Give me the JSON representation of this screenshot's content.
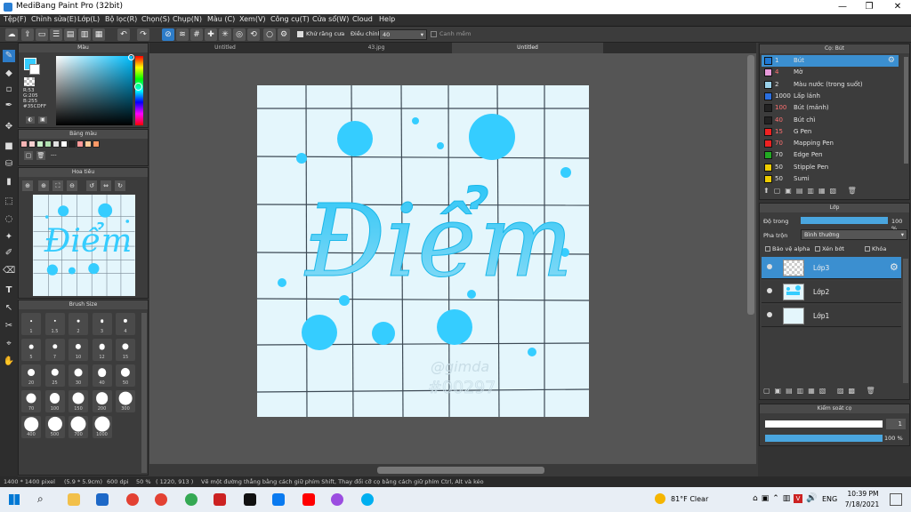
{
  "window": {
    "title": "MediBang Paint Pro (32bit)",
    "min": "—",
    "max": "❐",
    "close": "✕"
  },
  "menu": [
    "Tệp(F)",
    "Chỉnh sửa(E)",
    "Lớp(L)",
    "Bộ lọc(R)",
    "Chọn(S)",
    "Chụp(N)",
    "Màu (C)",
    "Xem(V)",
    "Công cụ(T)",
    "Cửa sổ(W)",
    "Cloud",
    "Help"
  ],
  "toolbar": {
    "antialias_label": "Khử răng cưa",
    "correction_label": "Điều chỉnh",
    "correction_value": "40",
    "smoothing_label": "Canh mềm"
  },
  "tabs": [
    "Untitled",
    "43.jpg",
    "Untitled"
  ],
  "panels": {
    "color": "Màu",
    "palette": "Bảng màu",
    "navigator": "Hoa tiêu",
    "brush_size": "Brush Size",
    "brush": "Cọ: Bút",
    "layer": "Lớp",
    "brush_control": "Kiểm soát cọ"
  },
  "color": {
    "r": "R:53",
    "g": "G:205",
    "b": "B:255",
    "hex": "#35CDFF",
    "fg": "#35cdff"
  },
  "palette": {
    "colors": [
      "#f5b5b5",
      "#f5d0d0",
      "#c8f0c8",
      "#b0e0b0",
      "#e0e0e0",
      "#ffffff",
      "#222222",
      "#ff9999",
      "#ffcc99",
      "#ff9966"
    ],
    "hint": "---"
  },
  "brushes": [
    {
      "size": "1",
      "name": "Bút",
      "color": "#1e78d4",
      "selected": true
    },
    {
      "size": "4",
      "name": "Mờ",
      "color": "#e89adb"
    },
    {
      "size": "2",
      "name": "Màu nước (trong suốt)",
      "color": "#9ad1ea"
    },
    {
      "size": "1000",
      "name": "Lấp lánh",
      "color": "#2a6fe0"
    },
    {
      "size": "100",
      "name": "Bút (mảnh)",
      "color": "#222222"
    },
    {
      "size": "40",
      "name": "Bút chì",
      "color": "#222222"
    },
    {
      "size": "15",
      "name": "G Pen",
      "color": "#ee2222"
    },
    {
      "size": "70",
      "name": "Mapping Pen",
      "color": "#ee2222"
    },
    {
      "size": "70",
      "name": "Edge Pen",
      "color": "#22aa22"
    },
    {
      "size": "50",
      "name": "Stipple Pen",
      "color": "#eecc00"
    },
    {
      "size": "50",
      "name": "Sumi",
      "color": "#eecc00"
    }
  ],
  "layer": {
    "opacity_label": "Độ trong",
    "opacity_value": "100 %",
    "blend_label": "Pha trộn",
    "blend_value": "Bình thường",
    "protect_alpha": "Bảo vệ alpha",
    "clipping": "Xén bớt",
    "lock": "Khóa",
    "layers": [
      {
        "name": "Lớp3",
        "selected": true
      },
      {
        "name": "Lớp2"
      },
      {
        "name": "Lớp1"
      }
    ]
  },
  "brush_control": {
    "size": "1",
    "opacity": "100 %"
  },
  "brush_sizes": [
    "1",
    "1.5",
    "2",
    "3",
    "4",
    "5",
    "7",
    "10",
    "12",
    "15",
    "20",
    "25",
    "30",
    "40",
    "50",
    "70",
    "100",
    "150",
    "200",
    "300",
    "400",
    "500",
    "700",
    "1000"
  ],
  "canvas": {
    "text": "Điểm",
    "watermark": "@gimda\n#00297"
  },
  "status": {
    "size": "1400 * 1400 pixel",
    "cm": "(5.9 * 5.9cm)",
    "dpi": "600 dpi",
    "zoom": "50 %",
    "coord": "( 1220, 913 )",
    "hint": "Vẽ một đường thẳng bằng cách giữ phím Shift, Thay đổi cỡ cọ bằng cách giữ phím Ctrl, Alt và kéo"
  },
  "taskbar": {
    "weather": "81°F  Clear",
    "lang": "ENG",
    "time": "10:39 PM",
    "date": "7/18/2021"
  }
}
